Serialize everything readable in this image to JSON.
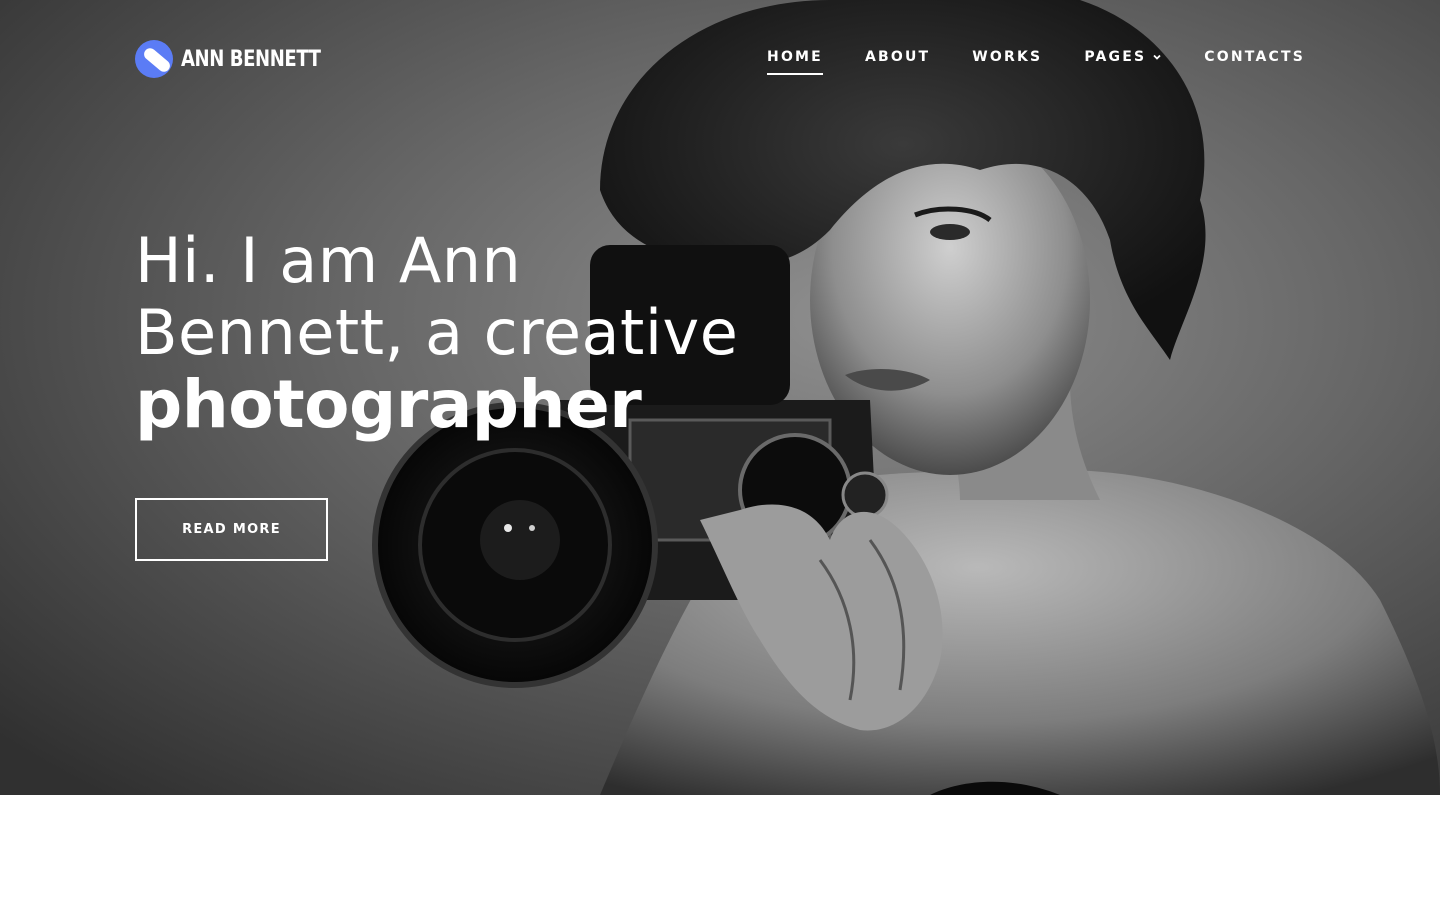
{
  "brand": {
    "name": "ANN BENNETT",
    "logo_icon": "logo-mark-icon",
    "accent_color": "#5b7cf5"
  },
  "nav": {
    "items": [
      {
        "label": "HOME",
        "active": true
      },
      {
        "label": "ABOUT",
        "active": false
      },
      {
        "label": "WORKS",
        "active": false
      },
      {
        "label": "PAGES",
        "active": false,
        "dropdown": true
      },
      {
        "label": "CONTACTS",
        "active": false
      }
    ]
  },
  "hero": {
    "headline_line1": "Hi. I am Ann",
    "headline_line2": "Bennett, a creative",
    "headline_bold": "photographer",
    "cta_label": "READ MORE",
    "image_icon": "photographer-portrait-image"
  }
}
